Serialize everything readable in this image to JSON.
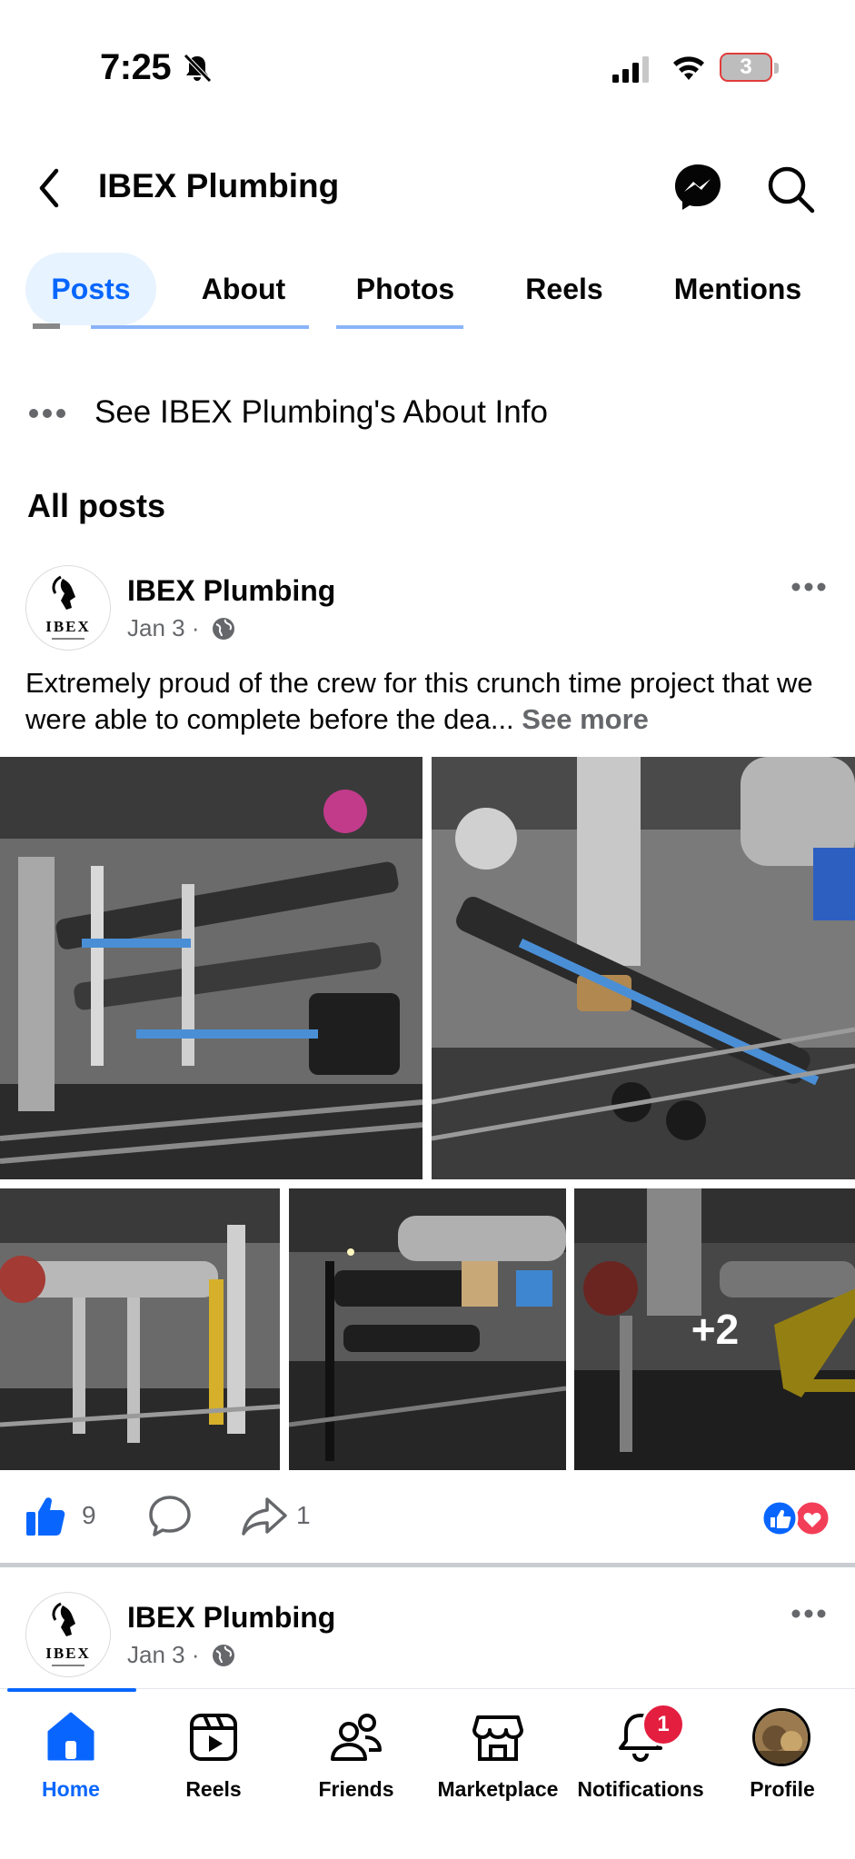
{
  "status_bar": {
    "time": "7:25",
    "battery": "3"
  },
  "header": {
    "title": "IBEX Plumbing",
    "icons": [
      "back-icon",
      "messenger-icon",
      "search-icon"
    ]
  },
  "tabs": [
    {
      "label": "Posts",
      "active": true
    },
    {
      "label": "About",
      "active": false
    },
    {
      "label": "Photos",
      "active": false
    },
    {
      "label": "Reels",
      "active": false
    },
    {
      "label": "Mentions",
      "active": false
    }
  ],
  "about_link": "See IBEX Plumbing's About Info",
  "section_heading": "All posts",
  "posts": [
    {
      "author": "IBEX Plumbing",
      "date": "Jan 3",
      "separator": "·",
      "text": "Extremely proud of the crew for this crunch time project that we were able to complete before the dea...",
      "see_more": "See more",
      "extra_photos": "+2",
      "likes": "9",
      "shares": "1"
    },
    {
      "author": "IBEX Plumbing",
      "date": "Jan 3",
      "separator": "·"
    }
  ],
  "logo_text": "IBEX",
  "bottom_nav": [
    {
      "label": "Home",
      "icon": "home-icon",
      "active": true
    },
    {
      "label": "Reels",
      "icon": "reels-icon",
      "active": false
    },
    {
      "label": "Friends",
      "icon": "friends-icon",
      "active": false
    },
    {
      "label": "Marketplace",
      "icon": "marketplace-icon",
      "active": false
    },
    {
      "label": "Notifications",
      "icon": "bell-icon",
      "active": false
    },
    {
      "label": "Profile",
      "icon": "profile-avatar",
      "active": false
    }
  ],
  "notification_count": "1",
  "colors": {
    "accent": "#0866ff",
    "active_tab_bg": "#e7f3ff",
    "badge": "#e41e3f",
    "secondary_text": "#65676b"
  }
}
